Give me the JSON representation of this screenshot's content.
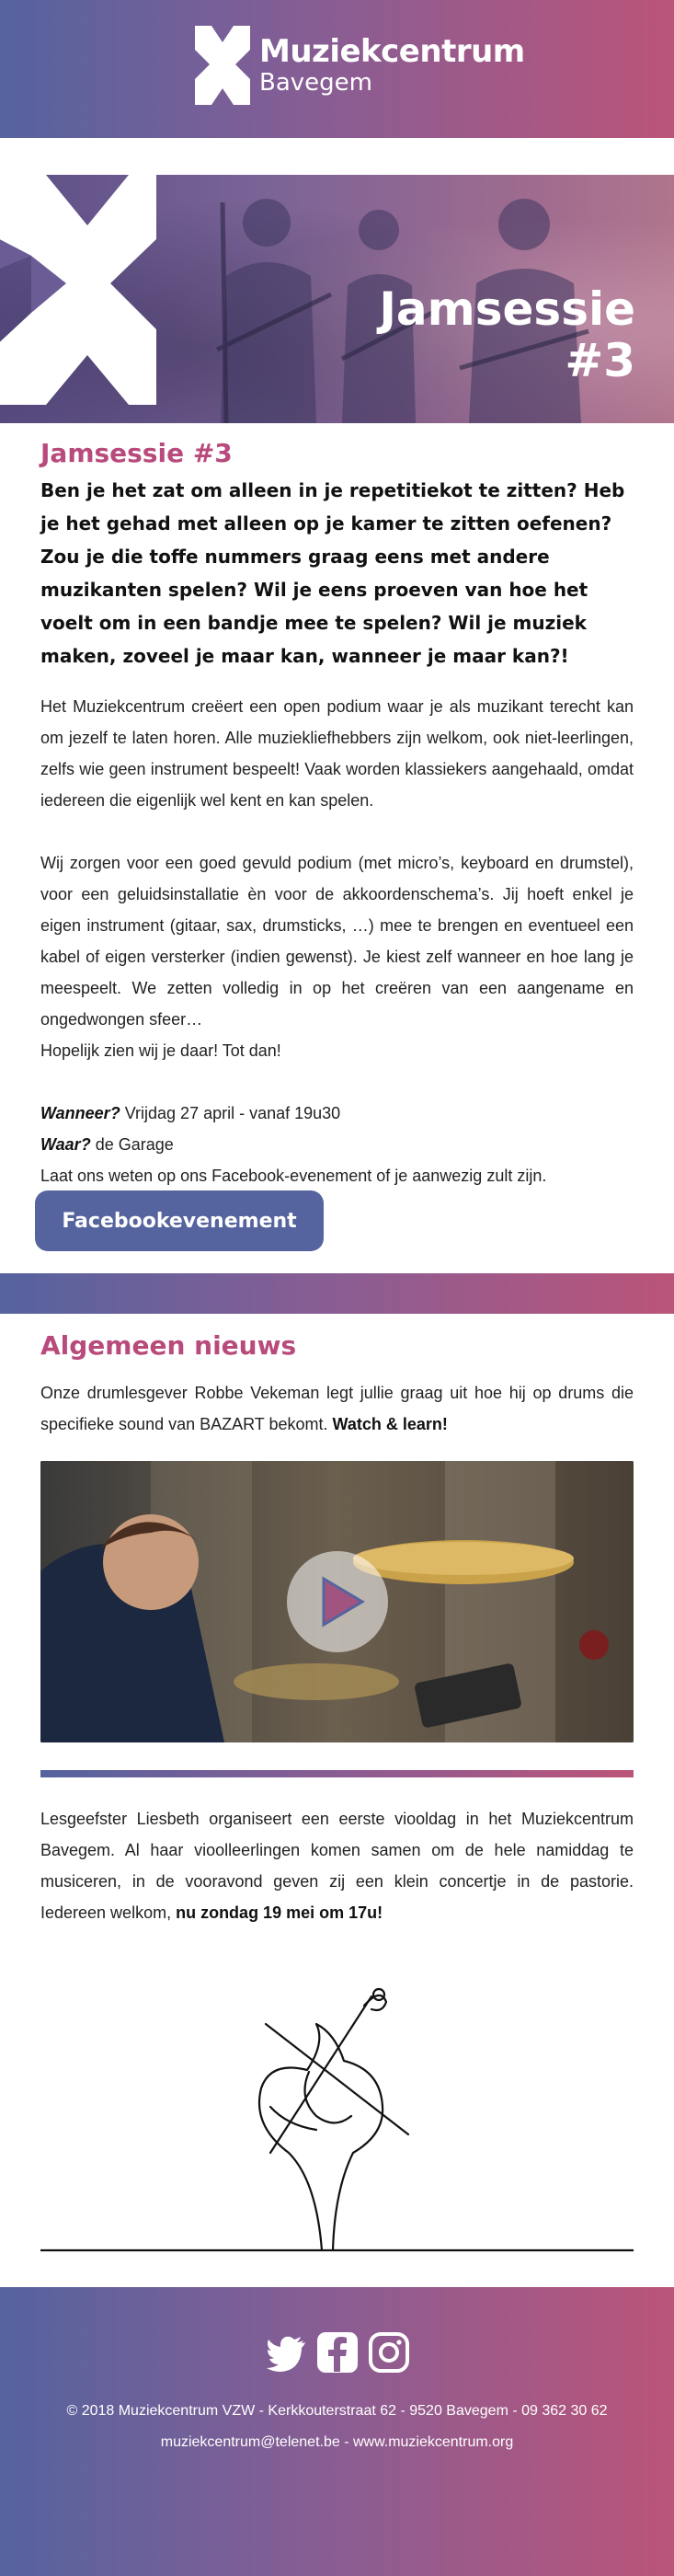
{
  "brand": {
    "name": "Muziekcentrum",
    "location": "Bavegem",
    "colors": {
      "blue": "#55639f",
      "pink": "#b84a7c",
      "purple": "#8a5d93"
    }
  },
  "hero": {
    "title_line1": "Jamsessie",
    "title_line2": "#3"
  },
  "event": {
    "heading": "Jamsessie #3",
    "lead": "Ben je het zat om alleen in je repetitiekot te zitten? Heb je het gehad met alleen op je kamer te zitten oefenen? Zou je die toffe nummers graag eens met andere muzikanten spelen? Wil je eens proeven van hoe het voelt om in een bandje mee te spelen? Wil je muziek maken, zoveel je maar kan, wanneer je maar kan?!",
    "para1": "Het Muziekcentrum creëert een open podium waar je als muzikant terecht kan om jezelf te laten horen. Alle muziekliefhebbers zijn welkom, ook niet-leerlingen, zelfs wie geen instrument bespeelt! Vaak worden klassiekers aangehaald, omdat iedereen die eigenlijk wel kent en kan spelen.",
    "para2": "Wij zorgen voor een goed gevuld podium (met micro’s, keyboard en drumstel), voor een geluidsinstallatie èn voor de akkoordenschema’s. Jij hoeft enkel je eigen instrument (gitaar, sax, drumsticks, …) mee te brengen en eventueel een kabel of eigen versterker (indien gewenst). Je kiest zelf wanneer en hoe lang je meespeelt. We zetten volledig in op het creëren van een aangename en ongedwongen sfeer…",
    "closing": "Hopelijk zien wij je daar! Tot dan!",
    "when_label": "Wanneer?",
    "when_value": " Vrijdag 27 april - vanaf 19u30",
    "where_label": "Waar?",
    "where_value": " de Garage",
    "rsvp": "Laat ons weten op ons Facebook-evenement of je aanwezig zult zijn.",
    "button_label": "Facebookevenement"
  },
  "news": {
    "heading": "Algemeen nieuws",
    "item1_text": "Onze drumlesgever Robbe Vekeman legt jullie graag uit hoe hij op drums die specifieke sound van BAZART bekomt. ",
    "item1_bold": "Watch & learn!",
    "item2_text": "Lesgeefster Liesbeth organiseert een eerste viooldag in het Muziekcentrum Bavegem. Al haar viool­leerlingen komen samen om de hele namiddag te musiceren, in de vooravond geven zij een klein concertje in de pastorie. Iedereen welkom, ",
    "item2_bold": "nu zondag 19 mei om 17u!"
  },
  "footer": {
    "icons": [
      "twitter-icon",
      "facebook-icon",
      "instagram-icon"
    ],
    "line1": "© 2018 Muziekcentrum VZW - Kerkkouterstraat 62 - 9520 Bavegem - 09 362 30 62",
    "line2": "muziekcentrum@telenet.be - www.muziekcentrum.org"
  }
}
